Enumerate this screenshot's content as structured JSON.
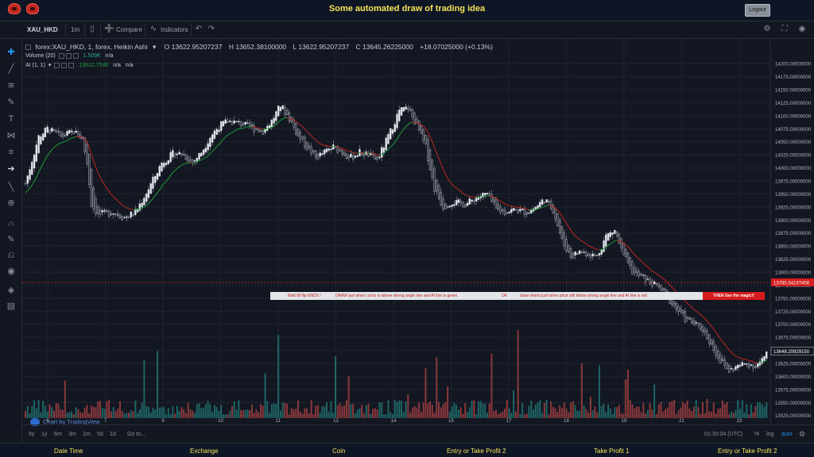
{
  "header": {
    "title": "Some automated draw of trading idea",
    "logout_label": "Logout"
  },
  "toolbar": {
    "symbol": "XAU_HKD",
    "interval": "1m",
    "compare_label": "Compare",
    "indicators_label": "Indicators"
  },
  "legend": {
    "title": "forex:XAU_HKD, 1, forex, Heikin Ashi",
    "open": "O 13622.95207237",
    "high": "H 13652.38100000",
    "low": "L 13622.95207237",
    "close": "C 13645.26225000",
    "change": "+18.07025000 (+0.13%)",
    "volume_label": "Volume (20)",
    "volume_value": "1.509K",
    "volume_na": "n/a",
    "ai_label": "AI (1, 1)",
    "ai_value": "13612.7546",
    "ai_na1": "n/a",
    "ai_na2": "n/a"
  },
  "annotation": {
    "text1": "Wait till flip ENDS  !",
    "text2": "DRAW just when:  price is above strong angle line and AI line is green",
    "text3": "OK",
    "text4": "draw shorts just when price still below strong angle line and AI line is red",
    "then": "THEN See the magic!!"
  },
  "price_scale": {
    "labels": [
      "14200.00000000",
      "14175.00000000",
      "14150.00000000",
      "14125.00000000",
      "14100.00000000",
      "14075.00000000",
      "14050.00000000",
      "14025.00000000",
      "14000.00000000",
      "13975.00000000",
      "13950.00000000",
      "13925.00000000",
      "13900.00000000",
      "13875.00000000",
      "13850.00000000",
      "13825.00000000",
      "13800.00000000",
      "13775.00000000",
      "13750.00000000",
      "13725.00000000",
      "13700.00000000",
      "13675.00000000",
      "13650.00000000",
      "13625.00000000",
      "13600.00000000",
      "13575.00000000",
      "13550.00000000",
      "13525.00000000"
    ],
    "marker_red": "13780.34197408",
    "marker_current": "13648.20929150"
  },
  "time_axis": [
    "6",
    "7",
    "9",
    "10",
    "11",
    "12",
    "14",
    "15",
    "17",
    "18",
    "19",
    "21",
    "23"
  ],
  "bottom_bar": {
    "ranges": [
      "5y",
      "1y",
      "6m",
      "3m",
      "1m",
      "5d",
      "1d"
    ],
    "goto": "Go to...",
    "clock": "01:30:04 (UTC)",
    "percent": "%",
    "log": "log",
    "auto": "auto"
  },
  "branding": "Chart by TradingView",
  "footer": [
    "Date Time",
    "Exchange",
    "Coin",
    "Entry or Take Profit 2",
    "Take Profit 1",
    "Entry or Take Profit 2"
  ],
  "colors": {
    "up": "#26a69a",
    "down": "#ef5350",
    "ai_up": "#1f9d3a",
    "ai_down": "#c0271f",
    "banner_text": "#f5e35a",
    "accent": "#2196f3"
  },
  "chart_data": {
    "type": "candlestick",
    "style": "Heikin Ashi",
    "ylim": [
      13520,
      14220
    ],
    "price_path": [
      [
        0,
        13970
      ],
      [
        6,
        14060
      ],
      [
        10,
        14075
      ],
      [
        16,
        14060
      ],
      [
        22,
        14070
      ],
      [
        26,
        14055
      ],
      [
        28,
        14010
      ],
      [
        30,
        13930
      ],
      [
        33,
        13910
      ],
      [
        40,
        13915
      ],
      [
        45,
        13905
      ],
      [
        50,
        13915
      ],
      [
        56,
        13960
      ],
      [
        62,
        14010
      ],
      [
        68,
        14030
      ],
      [
        72,
        14025
      ],
      [
        76,
        14010
      ],
      [
        80,
        14030
      ],
      [
        84,
        14060
      ],
      [
        88,
        14080
      ],
      [
        92,
        14090
      ],
      [
        98,
        14085
      ],
      [
        104,
        14075
      ],
      [
        108,
        14070
      ],
      [
        112,
        14090
      ],
      [
        116,
        14120
      ],
      [
        120,
        14095
      ],
      [
        124,
        14060
      ],
      [
        128,
        14040
      ],
      [
        132,
        14020
      ],
      [
        136,
        14030
      ],
      [
        140,
        14040
      ],
      [
        144,
        14030
      ],
      [
        148,
        14020
      ],
      [
        152,
        14030
      ],
      [
        156,
        14025
      ],
      [
        160,
        14015
      ],
      [
        166,
        14070
      ],
      [
        170,
        14110
      ],
      [
        174,
        14115
      ],
      [
        178,
        14080
      ],
      [
        182,
        14040
      ],
      [
        186,
        13960
      ],
      [
        190,
        13925
      ],
      [
        194,
        13935
      ],
      [
        200,
        13930
      ],
      [
        206,
        13945
      ],
      [
        210,
        13950
      ],
      [
        214,
        13920
      ],
      [
        218,
        13915
      ],
      [
        222,
        13920
      ],
      [
        228,
        13915
      ],
      [
        232,
        13925
      ],
      [
        236,
        13940
      ],
      [
        240,
        13920
      ],
      [
        244,
        13860
      ],
      [
        248,
        13830
      ],
      [
        252,
        13840
      ],
      [
        256,
        13835
      ],
      [
        260,
        13830
      ],
      [
        264,
        13870
      ],
      [
        268,
        13880
      ],
      [
        272,
        13830
      ],
      [
        276,
        13800
      ],
      [
        280,
        13790
      ],
      [
        284,
        13780
      ],
      [
        288,
        13770
      ],
      [
        292,
        13750
      ],
      [
        296,
        13730
      ],
      [
        300,
        13710
      ],
      [
        304,
        13700
      ],
      [
        308,
        13690
      ],
      [
        312,
        13660
      ],
      [
        316,
        13630
      ],
      [
        320,
        13610
      ],
      [
        324,
        13620
      ],
      [
        328,
        13625
      ],
      [
        332,
        13620
      ],
      [
        336,
        13635
      ],
      [
        338,
        13648
      ]
    ],
    "volume_range": [
      0,
      3200
    ]
  }
}
